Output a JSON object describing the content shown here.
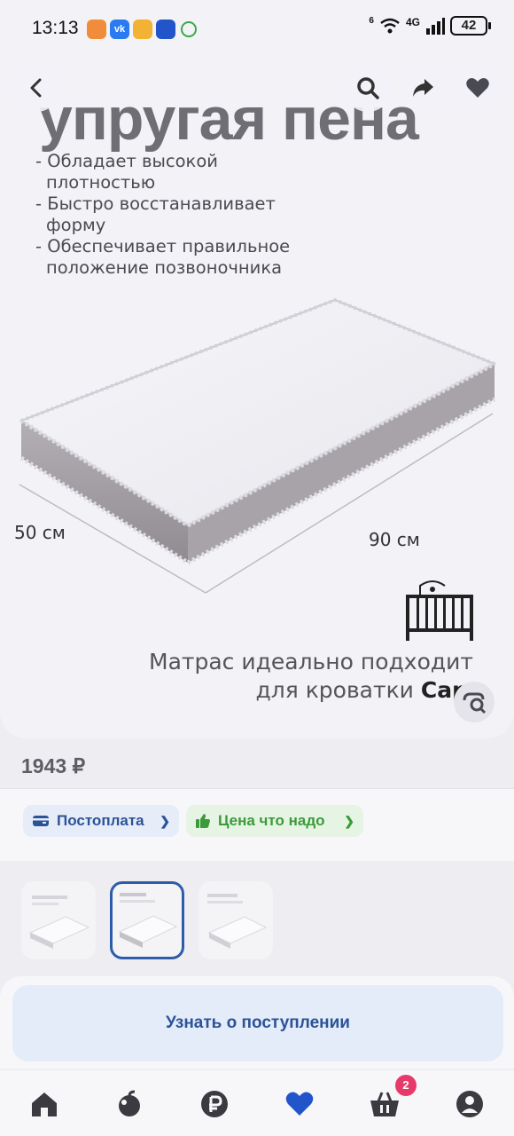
{
  "status_bar": {
    "time": "13:13",
    "network": "4G",
    "signal_prefix": "6",
    "battery": "42"
  },
  "gallery": {
    "hero_title": "упругая пена",
    "features": [
      "- Обладает высокой",
      "плотностью",
      "- Быстро восстанавливает",
      "форму",
      "- Обеспечивает правильное",
      "положение позвоночника"
    ],
    "dim_width": "50 см",
    "dim_length": "90 см",
    "caption_line1": "Матрас идеально подходит",
    "caption_line2": "для кроватки",
    "caption_brand": "Cap"
  },
  "product": {
    "price": "1943 ₽"
  },
  "chips": {
    "postpay": "Постоплата",
    "fair_price": "Цена что надо"
  },
  "cta": {
    "label": "Узнать о поступлении"
  },
  "tabbar": {
    "cart_badge": "2"
  },
  "colors": {
    "accent_blue": "#2c5297",
    "green": "#3b9a3a",
    "badge_pink": "#e83a6a",
    "heart_active": "#2155c9"
  },
  "icons": [
    "back-icon",
    "search-icon",
    "share-icon",
    "heart-icon",
    "zoom-icon",
    "home-icon",
    "catalog-icon",
    "ruble-icon",
    "favorites-icon",
    "cart-icon",
    "profile-icon"
  ]
}
